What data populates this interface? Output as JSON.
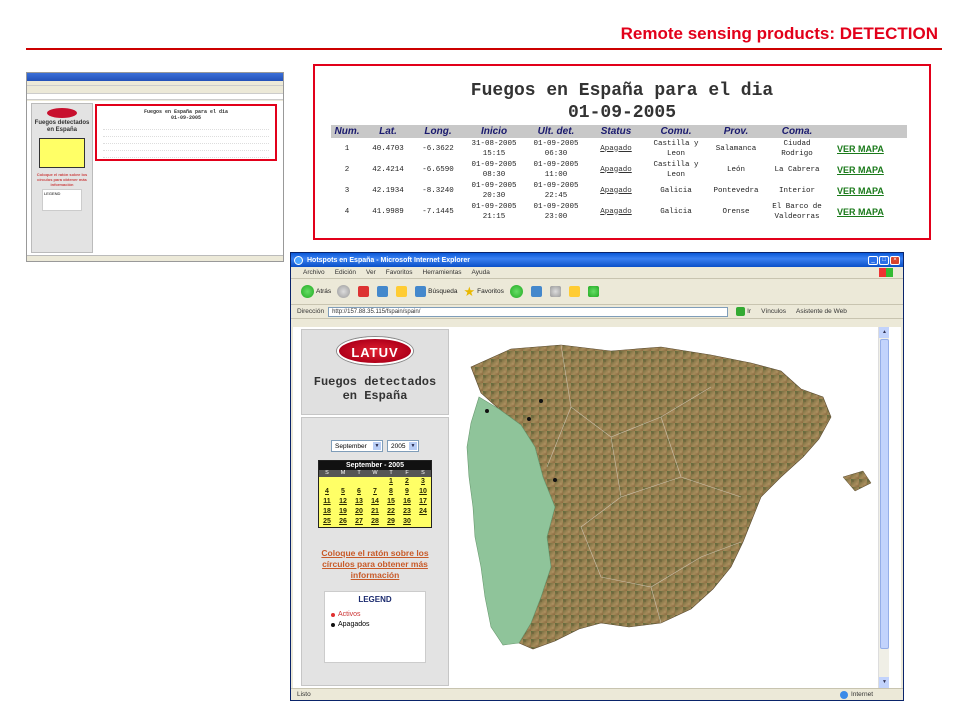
{
  "slide": {
    "title": "Remote sensing products: DETECTION"
  },
  "thumbnail": {
    "caption_title": "Fuegos detectados en España"
  },
  "zoom": {
    "title_line1": "Fuegos en España para el dia",
    "title_line2": "01-09-2005",
    "headers": [
      "Num.",
      "Lat.",
      "Long.",
      "Inicio",
      "Ult. det.",
      "Status",
      "Comu.",
      "Prov.",
      "Comа."
    ],
    "rows": [
      {
        "num": "1",
        "lat": "40.4703",
        "lon": "-6.3622",
        "inicio1": "31-08-2005",
        "inicio2": "15:15",
        "ult1": "01-09-2005",
        "ult2": "06:30",
        "status": "Apagado",
        "comu1": "Castilla y",
        "comu2": "Leon",
        "prov": "Salamanca",
        "coma1": "Ciudad",
        "coma2": "Rodrigo",
        "mapa": "VER MAPA"
      },
      {
        "num": "2",
        "lat": "42.4214",
        "lon": "-6.6590",
        "inicio1": "01-09-2005",
        "inicio2": "08:30",
        "ult1": "01-09-2005",
        "ult2": "11:00",
        "status": "Apagado",
        "comu1": "Castilla y",
        "comu2": "Leon",
        "prov": "León",
        "coma1": "La Cabrera",
        "coma2": "",
        "mapa": "VER MAPA"
      },
      {
        "num": "3",
        "lat": "42.1934",
        "lon": "-8.3240",
        "inicio1": "01-09-2005",
        "inicio2": "20:30",
        "ult1": "01-09-2005",
        "ult2": "22:45",
        "status": "Apagado",
        "comu1": "Galicia",
        "comu2": "",
        "prov": "Pontevedra",
        "coma1": "Interior",
        "coma2": "",
        "mapa": "VER MAPA"
      },
      {
        "num": "4",
        "lat": "41.9989",
        "lon": "-7.1445",
        "inicio1": "01-09-2005",
        "inicio2": "21:15",
        "ult1": "01-09-2005",
        "ult2": "23:00",
        "status": "Apagado",
        "comu1": "Galicia",
        "comu2": "",
        "prov": "Orense",
        "coma1": "El Barco de",
        "coma2": "Valdeorras",
        "mapa": "VER MAPA"
      }
    ]
  },
  "browser": {
    "window_title": "Hotspots en España - Microsoft Internet Explorer",
    "menu": [
      "Archivo",
      "Edición",
      "Ver",
      "Favoritos",
      "Herramientas",
      "Ayuda"
    ],
    "toolbar": {
      "back": "Atrás",
      "search": "Búsqueda",
      "favorites": "Favoritos"
    },
    "address": {
      "label": "Dirección",
      "url": "http://157.88.35.115/fspain/spain/",
      "go": "Ir",
      "links": "Vínculos",
      "assistant": "Asistente de Web"
    },
    "sidebar": {
      "logo": "LATUV",
      "title_line1": "Fuegos detectados",
      "title_line2": "en España",
      "month_select": "September",
      "year_select": "2005",
      "calendar_header": "September - 2005",
      "dow": [
        "S",
        "M",
        "T",
        "W",
        "T",
        "F",
        "S"
      ],
      "days": [
        "",
        "",
        "",
        "",
        "1",
        "2",
        "3",
        "4",
        "5",
        "6",
        "7",
        "8",
        "9",
        "10",
        "11",
        "12",
        "13",
        "14",
        "15",
        "16",
        "17",
        "18",
        "19",
        "20",
        "21",
        "22",
        "23",
        "24",
        "25",
        "26",
        "27",
        "28",
        "29",
        "30",
        ""
      ],
      "info_link": "Coloque el ratón sobre los círculos para obtener más información",
      "legend_title": "LEGEND",
      "legend_active": "Activos",
      "legend_off": "Apagados"
    },
    "status": {
      "left": "Listo",
      "zone": "Internet"
    }
  },
  "colors": {
    "accent": "#e2001a",
    "calendar": "#ffff66",
    "portugal": "#8fc49a",
    "active_dot": "#e03030",
    "off_dot": "#111111"
  }
}
